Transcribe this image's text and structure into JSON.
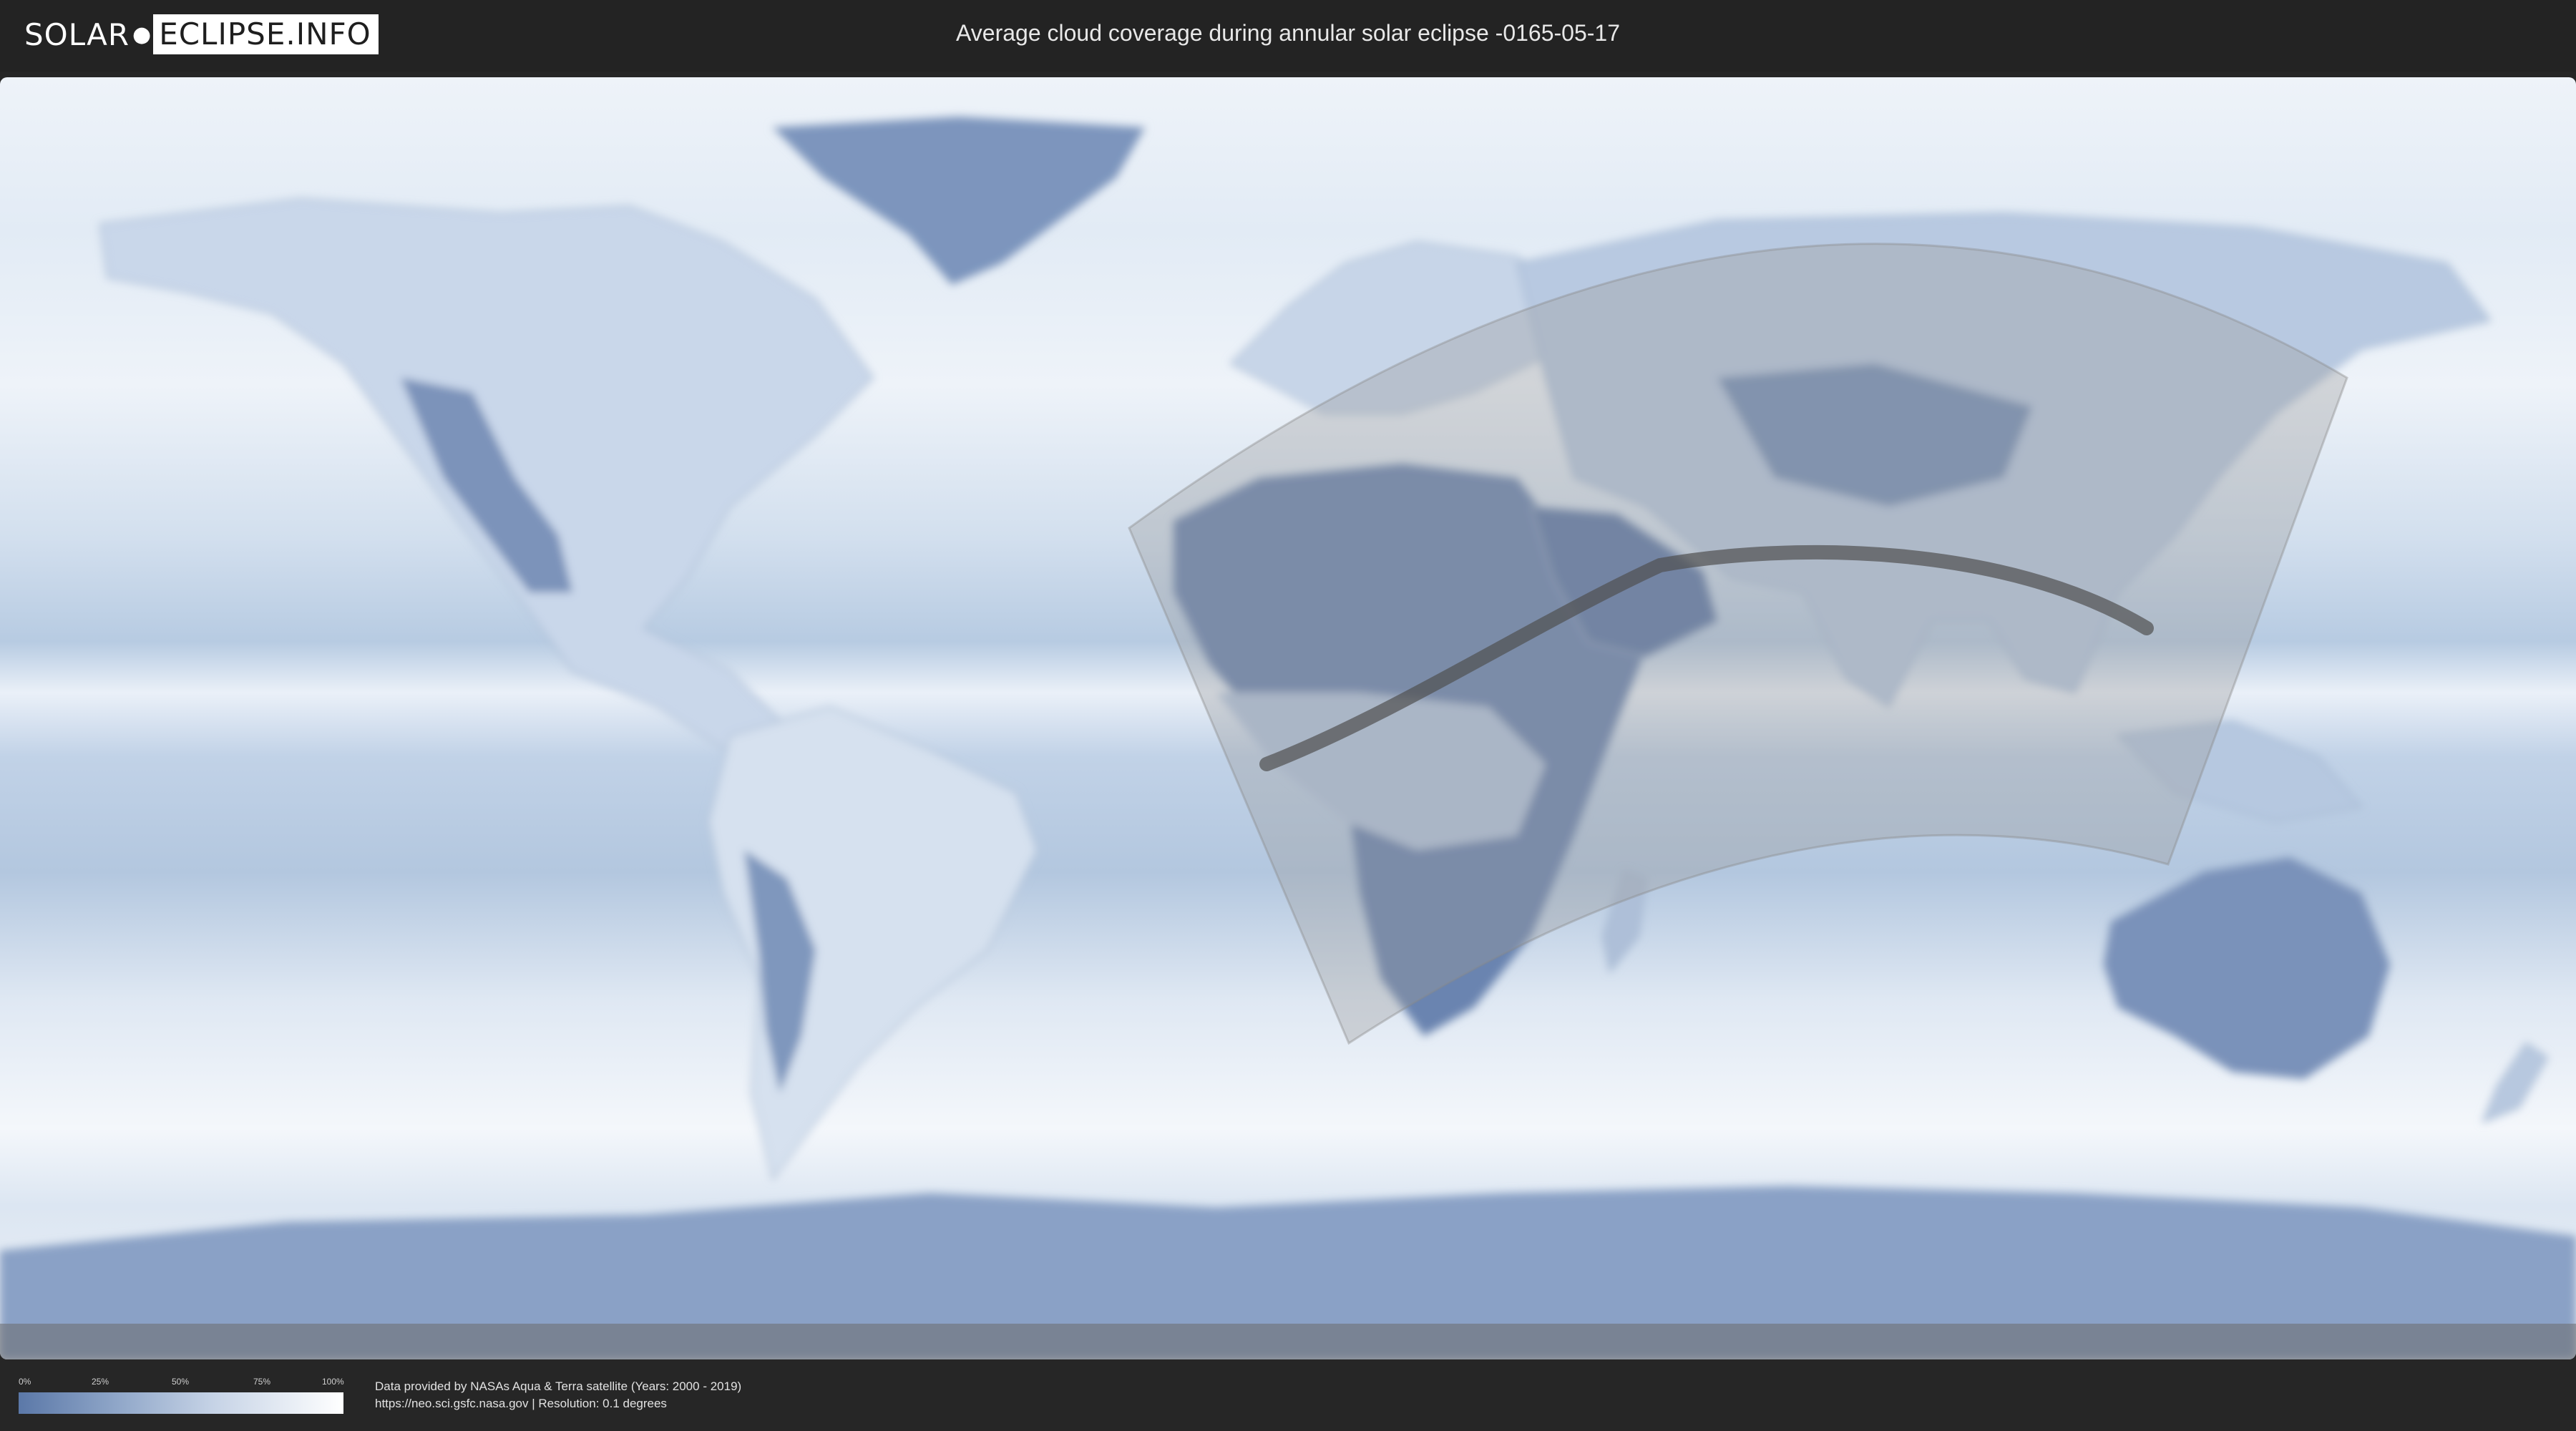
{
  "header": {
    "logo_part1": "SOLAR",
    "logo_part2": "ECLIPSE.INFO",
    "title": "Average cloud coverage during annular solar eclipse -0165-05-17"
  },
  "legend": {
    "ticks": [
      "0%",
      "25%",
      "50%",
      "75%",
      "100%"
    ],
    "colors": {
      "low": "#5b78a8",
      "high": "#ffffff"
    }
  },
  "footer": {
    "credit_line1": "Data provided by NASAs Aqua & Terra satellite (Years: 2000 - 2019)",
    "credit_line2": "https://neo.sci.gsfc.nasa.gov | Resolution: 0.1 degrees"
  },
  "map": {
    "projection": "equirectangular",
    "colors": {
      "ocean_clear": "#b9cde3",
      "cloudy": "#eef3f9",
      "clear_land": "#6d85b0",
      "penumbra_overlay": "#9a9a9a",
      "eclipse_path": "#505050"
    }
  }
}
